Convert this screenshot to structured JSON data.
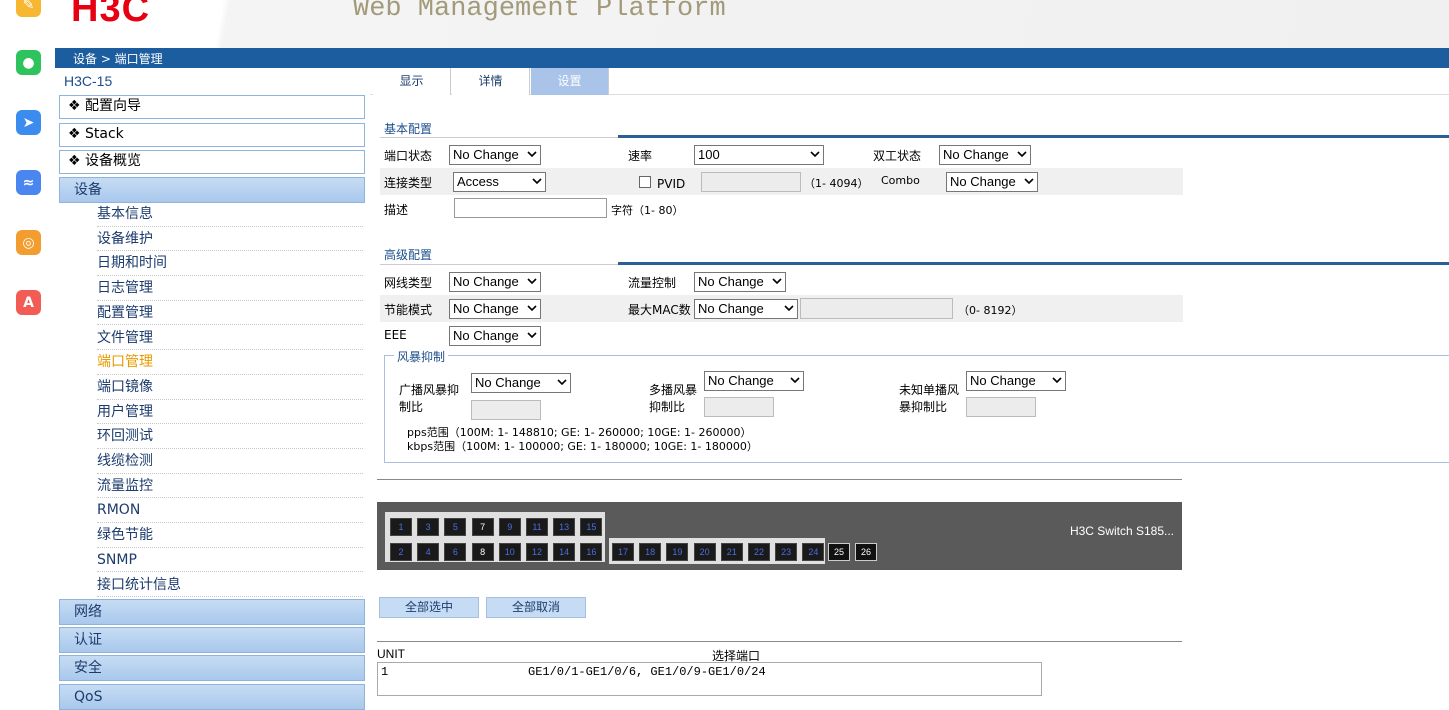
{
  "header": {
    "logo": "H3C",
    "platform": "Web Management Platform"
  },
  "breadcrumb": "设备 > 端口管理",
  "sidebar": {
    "device_name": "H3C-15",
    "top_items": [
      "❖ 配置向导",
      "❖ Stack",
      "❖ 设备概览"
    ],
    "section": "设备",
    "sub_items": [
      "基本信息",
      "设备维护",
      "日期和时间",
      "日志管理",
      "配置管理",
      "文件管理",
      "端口管理",
      "端口镜像",
      "用户管理",
      "环回测试",
      "线缆检测",
      "流量监控",
      "RMON",
      "绿色节能",
      "SNMP",
      "接口统计信息"
    ],
    "active_sub": "端口管理",
    "bottom_items": [
      "网络",
      "认证",
      "安全",
      "QoS"
    ]
  },
  "tabs": [
    "显示",
    "详情",
    "设置"
  ],
  "selected_tab": "设置",
  "basic": {
    "title": "基本配置",
    "port_status_label": "端口状态",
    "port_status": "No Change",
    "speed_label": "速率",
    "speed": "100",
    "duplex_label": "双工状态",
    "duplex": "No Change",
    "link_type_label": "连接类型",
    "link_type": "Access",
    "pvid_label": "PVID",
    "pvid_range": "（1- 4094）",
    "combo_label": "Combo",
    "combo": "No Change",
    "desc_label": "描述",
    "desc_hint": "字符（1- 80）"
  },
  "advanced": {
    "title": "高级配置",
    "mdi_label": "网线类型",
    "mdi": "No Change",
    "flow_label": "流量控制",
    "flow": "No Change",
    "power_label": "节能模式",
    "power": "No Change",
    "maxmac_label": "最大MAC数",
    "maxmac": "No Change",
    "maxmac_range": "（0- 8192）",
    "eee_label": "EEE",
    "eee": "No Change"
  },
  "storm": {
    "legend": "风暴抑制",
    "broadcast_label_1": "广播风暴抑",
    "broadcast_label_2": "制比",
    "broadcast": "No Change",
    "multicast_label_1": "多播风暴",
    "multicast_label_2": "抑制比",
    "multicast": "No Change",
    "unicast_label_1": "未知单播风",
    "unicast_label_2": "暴抑制比",
    "unicast": "No Change",
    "pps_range": "pps范围（100M: 1- 148810; GE: 1- 260000; 10GE: 1- 260000）",
    "kbps_range": "kbps范围（100M: 1- 100000; GE: 1- 180000; 10GE: 1- 180000）"
  },
  "switch": {
    "name": "H3C Switch S185...",
    "top_ports": [
      "1",
      "3",
      "5",
      "7",
      "9",
      "11",
      "13",
      "15"
    ],
    "bottom_ports_a": [
      "2",
      "4",
      "6",
      "8",
      "10",
      "12",
      "14",
      "16"
    ],
    "bottom_ports_b": [
      "17",
      "18",
      "19",
      "20",
      "21",
      "22",
      "23",
      "24"
    ],
    "sfp_ports": [
      "25",
      "26"
    ],
    "selected_ports": [
      "1",
      "2",
      "3",
      "4",
      "5",
      "6",
      "9",
      "10",
      "11",
      "12",
      "13",
      "14",
      "15",
      "16",
      "17",
      "18",
      "19",
      "20",
      "21",
      "22",
      "23",
      "24"
    ]
  },
  "buttons": {
    "select_all": "全部选中",
    "deselect_all": "全部取消"
  },
  "selection": {
    "col_unit": "UNIT",
    "col_ports": "选择端口",
    "row_unit": "1",
    "row_ports": "GE1/0/1-GE1/0/6, GE1/0/9-GE1/0/24"
  },
  "dock_icons": [
    "notes-icon",
    "wechat-icon",
    "feishu-icon",
    "lark-icon",
    "search-app-icon",
    "ai-app-icon"
  ]
}
